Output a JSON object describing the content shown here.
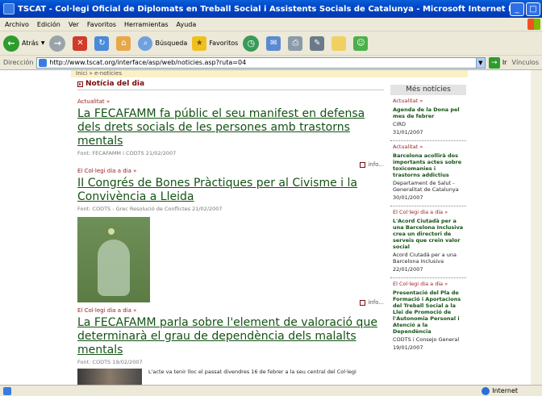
{
  "window": {
    "title": "TSCAT - Col·legi Oficial de Diplomats en Treball Social i Assistents Socials de Catalunya - Microsoft Internet Explorer"
  },
  "menu": [
    "Archivo",
    "Edición",
    "Ver",
    "Favoritos",
    "Herramientas",
    "Ayuda"
  ],
  "toolbar": {
    "back": "Atrás",
    "search": "Búsqueda",
    "favorites": "Favoritos"
  },
  "address": {
    "label": "Dirección",
    "url": "http://www.tscat.org/interface/asp/web/noticies.asp?ruta=04",
    "go": "Ir",
    "links": "Vínculos"
  },
  "breadcrumb": "Inici » e-notícies",
  "main": {
    "section_title": "Notícia del dia",
    "info_label": "info...",
    "stories": [
      {
        "category": "Actualitat »",
        "headline": "La FECAFAMM fa públic el seu manifest en defensa dels drets socials de les persones amb trastorns mentals",
        "source": "Font: FECAFAMM i CODTS  21/02/2007"
      },
      {
        "category": "El Col·legi dia a dia »",
        "headline": "II Congrés de Bones Pràctiques per al Civisme i la Convivència a Lleida",
        "source": "Font: CODTS - Grec Resolució de Conflictes  21/02/2007"
      },
      {
        "category": "El Col·legi dia a dia »",
        "headline": "La FECAFAMM parla sobre l'element de valoració que determinarà el grau de dependència dels malalts mentals",
        "source": "Font: CODTS  19/02/2007",
        "description": "L'acte va tenir lloc el passat divendres 16 de febrer a la seu central del Col·legi"
      }
    ]
  },
  "sidebar": {
    "title": "Més notícies",
    "items": [
      {
        "category": "Actualitat »",
        "title": "Agenda de la Dona pel mes de febrer",
        "source": "CIRD",
        "date": "31/01/2007"
      },
      {
        "category": "Actualitat »",
        "title": "Barcelona acollirà dos importants actes sobre toxicomanies i trastorns addictius",
        "source": "Departament de Salut - Generalitat de Catalunya",
        "date": "30/01/2007"
      },
      {
        "category": "El Col·legi dia a dia »",
        "title": "L'Acord Ciutadà per a una Barcelona Inclusiva crea un directori de serveis que creïn valor social",
        "source": "Acord Ciutadà per a una Barcelona Inclusiva",
        "date": "22/01/2007"
      },
      {
        "category": "El Col·legi dia a dia »",
        "title": "Presentació del Pla de Formació i Aportacions del Treball Social a la Llei de Promoció de l'Autonomia Personal i Atenció a la Dependència",
        "source": "CODTS i Consejo General",
        "date": "19/01/2007"
      }
    ]
  },
  "status": {
    "zone": "Internet"
  }
}
